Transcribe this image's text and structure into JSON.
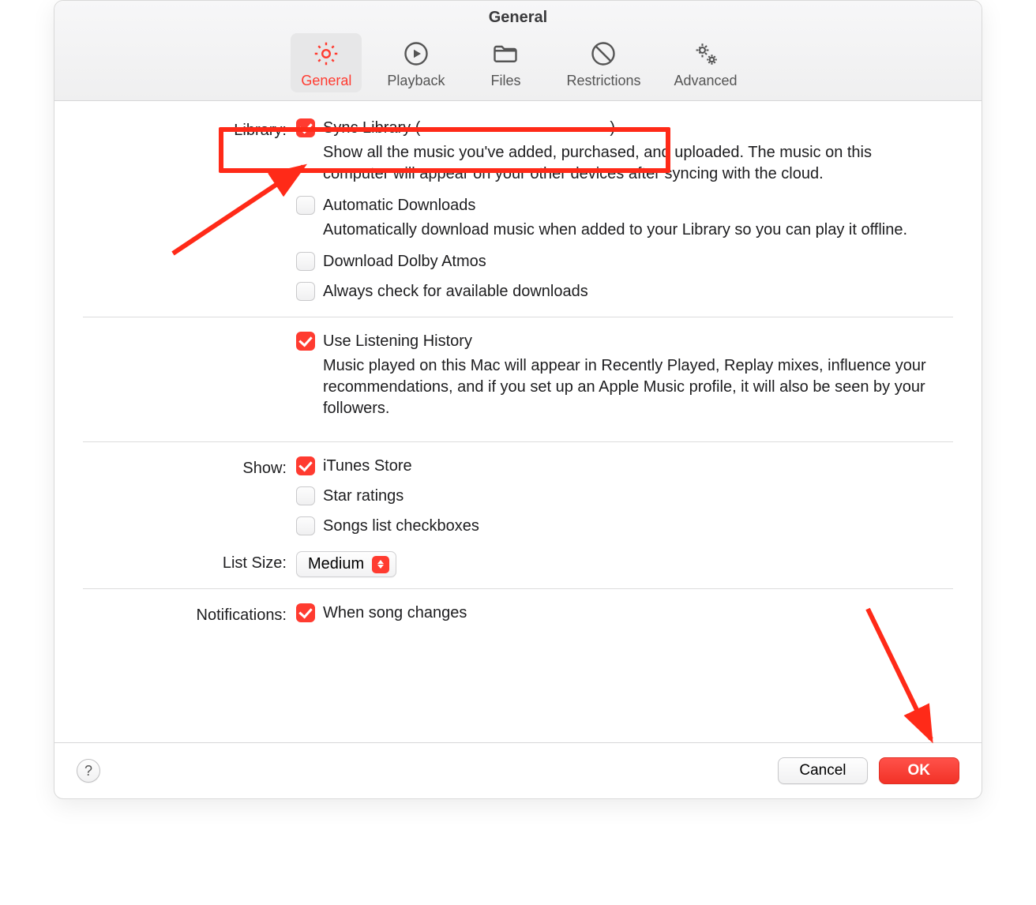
{
  "window": {
    "title": "General"
  },
  "tabs": [
    {
      "id": "general",
      "label": "General",
      "active": true
    },
    {
      "id": "playback",
      "label": "Playback",
      "active": false
    },
    {
      "id": "files",
      "label": "Files",
      "active": false
    },
    {
      "id": "restrictions",
      "label": "Restrictions",
      "active": false
    },
    {
      "id": "advanced",
      "label": "Advanced",
      "active": false
    }
  ],
  "sections": {
    "library": {
      "label": "Library:",
      "sync": {
        "text_before": "Sync Library (",
        "text_after": ")",
        "checked": true,
        "desc": "Show all the music you've added, purchased, and uploaded. The music on this computer will appear on your other devices after syncing with the cloud."
      },
      "auto_downloads": {
        "label": "Automatic Downloads",
        "checked": false,
        "desc": "Automatically download music when added to your Library so you can play it offline."
      },
      "dolby": {
        "label": "Download Dolby Atmos",
        "checked": false
      },
      "always": {
        "label": "Always check for available downloads",
        "checked": false
      }
    },
    "listening": {
      "label": "Use Listening History",
      "checked": true,
      "desc": "Music played on this Mac will appear in Recently Played, Replay mixes, influence your recommendations, and if you set up an Apple Music profile, it will also be seen by your followers."
    },
    "show": {
      "label": "Show:",
      "itunes": {
        "label": "iTunes Store",
        "checked": true
      },
      "star": {
        "label": "Star ratings",
        "checked": false
      },
      "songs": {
        "label": "Songs list checkboxes",
        "checked": false
      }
    },
    "list_size": {
      "label": "List Size:",
      "value": "Medium"
    },
    "notifications": {
      "label": "Notifications:",
      "song_changes": {
        "label": "When song changes",
        "checked": true
      }
    }
  },
  "footer": {
    "help": "?",
    "cancel": "Cancel",
    "ok": "OK"
  }
}
